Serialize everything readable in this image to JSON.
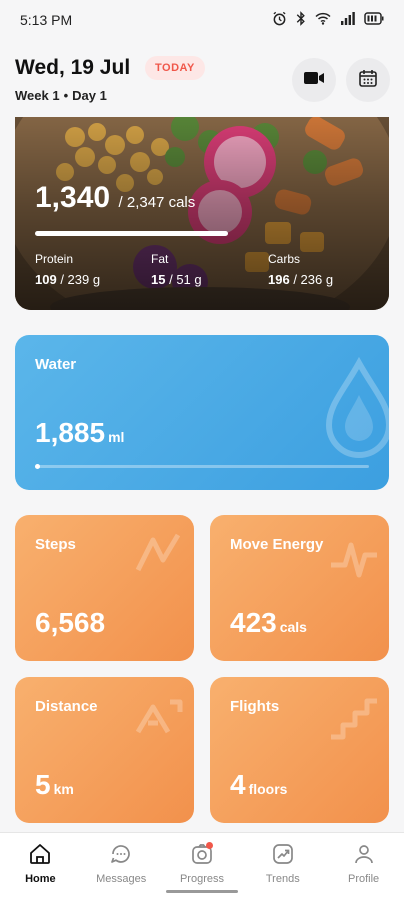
{
  "status_bar": {
    "time": "5:13 PM",
    "icons": [
      "alarm-icon",
      "bluetooth-icon",
      "wifi-icon",
      "signal-icon",
      "battery-icon"
    ]
  },
  "header": {
    "date": "Wed, 19 Jul",
    "today_badge": "TODAY",
    "week": "Week 1",
    "separator": "•",
    "day": "Day 1"
  },
  "calories": {
    "value": "1,340",
    "goal": "/ 2,347 cals",
    "progress": 0.57,
    "macros": [
      {
        "label": "Protein",
        "value": "109",
        "goal": "/ 239 g"
      },
      {
        "label": "Fat",
        "value": "15",
        "goal": "/ 51 g"
      },
      {
        "label": "Carbs",
        "value": "196",
        "goal": "/ 236 g"
      }
    ]
  },
  "water": {
    "title": "Water",
    "value": "1,885",
    "unit": "ml"
  },
  "tiles": {
    "steps": {
      "title": "Steps",
      "value": "6,568",
      "unit": ""
    },
    "move": {
      "title": "Move Energy",
      "value": "423",
      "unit": "cals"
    },
    "distance": {
      "title": "Distance",
      "value": "5",
      "unit": "km"
    },
    "flights": {
      "title": "Flights",
      "value": "4",
      "unit": "floors"
    }
  },
  "nav": [
    {
      "label": "Home",
      "icon": "home-icon",
      "active": true
    },
    {
      "label": "Messages",
      "icon": "messages-icon"
    },
    {
      "label": "Progress",
      "icon": "progress-icon",
      "badge": true
    },
    {
      "label": "Trends",
      "icon": "trends-icon"
    },
    {
      "label": "Profile",
      "icon": "profile-icon"
    }
  ],
  "colors": {
    "accent_red": "#f0574a",
    "water_blue": "#3c9fe0",
    "tile_orange": "#f2914c"
  }
}
